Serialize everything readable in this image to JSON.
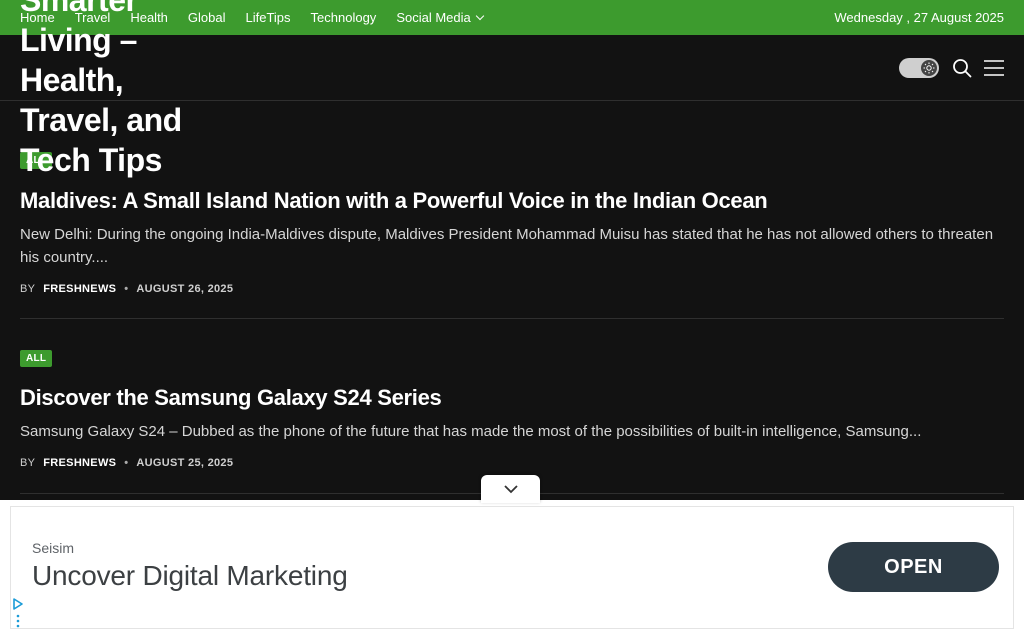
{
  "topbar": {
    "nav": [
      {
        "label": "Home"
      },
      {
        "label": "Travel"
      },
      {
        "label": "Health"
      },
      {
        "label": "Global"
      },
      {
        "label": "LifeTips"
      },
      {
        "label": "Technology"
      },
      {
        "label": "Social Media",
        "has_dropdown": true
      }
    ],
    "date": "Wednesday , 27 August 2025",
    "color": "#3d9b2e"
  },
  "header": {
    "site_title": "Smarter Living – Health, Travel, and Tech Tips",
    "icons": [
      "theme-toggle-icon",
      "search-icon",
      "menu-icon"
    ]
  },
  "articles": [
    {
      "badge": "ALL",
      "title": "Maldives: A Small Island Nation with a Powerful Voice in the Indian Ocean",
      "excerpt": "New Delhi: During the ongoing India-Maldives dispute, Maldives President Mohammad Muisu has stated that he has not allowed others to threaten his country....",
      "by": "BY",
      "author": "FRESHNEWS",
      "date": "AUGUST 26, 2025"
    },
    {
      "badge": "ALL",
      "title": "Discover the Samsung Galaxy S24 Series",
      "excerpt": "Samsung Galaxy S24 – Dubbed as the phone of the future that has made the most of the possibilities of built-in intelligence, Samsung...",
      "by": "BY",
      "author": "FRESHNEWS",
      "date": "AUGUST 25, 2025"
    }
  ],
  "ad": {
    "advertiser": "Seisim",
    "headline": "Uncover Digital Marketing",
    "cta": "OPEN",
    "cta_color": "#2d3b45"
  }
}
